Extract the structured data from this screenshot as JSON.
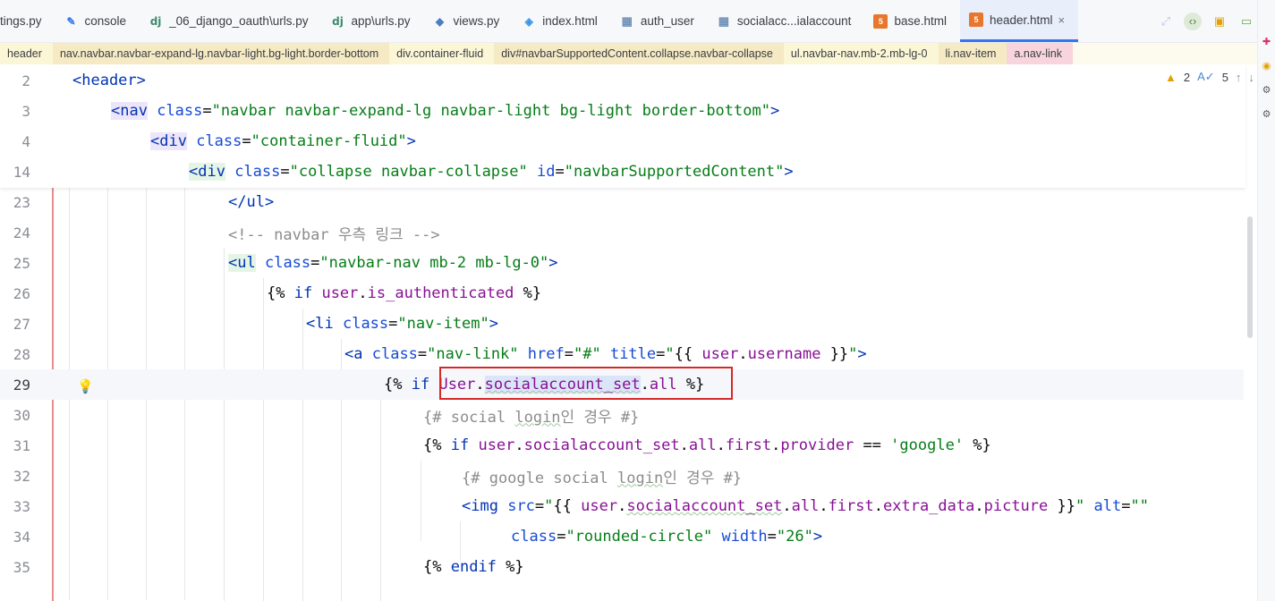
{
  "tabs": [
    {
      "label": "tings.py",
      "icon": "python-file-icon",
      "active": false
    },
    {
      "label": "console",
      "icon": "console-icon",
      "active": false
    },
    {
      "label": "_06_django_oauth\\urls.py",
      "icon": "django-icon",
      "active": false
    },
    {
      "label": "app\\urls.py",
      "icon": "django-icon",
      "active": false
    },
    {
      "label": "views.py",
      "icon": "python-file-icon",
      "active": false
    },
    {
      "label": "index.html",
      "icon": "vue-file-icon",
      "active": false
    },
    {
      "label": "auth_user",
      "icon": "table-icon",
      "active": false
    },
    {
      "label": "socialacc...ialaccount",
      "icon": "table-icon",
      "active": false
    },
    {
      "label": "base.html",
      "icon": "html-file-icon",
      "active": false
    },
    {
      "label": "header.html",
      "icon": "html-file-icon",
      "active": true
    }
  ],
  "breadcrumb": [
    "header",
    "nav.navbar.navbar-expand-lg.navbar-light.bg-light.border-bottom",
    "div.container-fluid",
    "div#navbarSupportedContent.collapse.navbar-collapse",
    "ul.navbar-nav.mb-2.mb-lg-0",
    "li.nav-item",
    "a.nav-link"
  ],
  "inspections": {
    "warnings": "2",
    "typos": "5"
  },
  "sticky_lines": [
    {
      "num": "2",
      "tokens": [
        [
          "tag",
          "<header>"
        ]
      ]
    },
    {
      "num": "3",
      "tokens": [
        [
          "tag tagbg",
          "<nav"
        ],
        [
          "plain",
          " "
        ],
        [
          "attr",
          "class"
        ],
        [
          "plain",
          "="
        ],
        [
          "str",
          "\"navbar navbar-expand-lg navbar-light bg-light border-bottom\""
        ],
        [
          "tag",
          ">"
        ]
      ]
    },
    {
      "num": "4",
      "tokens": [
        [
          "tag tagbg",
          "<div"
        ],
        [
          "plain",
          " "
        ],
        [
          "attr",
          "class"
        ],
        [
          "plain",
          "="
        ],
        [
          "str",
          "\"container-fluid\""
        ],
        [
          "tag",
          ">"
        ]
      ]
    },
    {
      "num": "14",
      "tokens": [
        [
          "tag tagbg2",
          "<div"
        ],
        [
          "plain",
          " "
        ],
        [
          "attr",
          "class"
        ],
        [
          "plain",
          "="
        ],
        [
          "str",
          "\"collapse navbar-collapse\""
        ],
        [
          "plain",
          " "
        ],
        [
          "attr",
          "id"
        ],
        [
          "plain",
          "="
        ],
        [
          "str",
          "\"navbarSupportedContent\""
        ],
        [
          "tag",
          ">"
        ]
      ]
    }
  ],
  "lines": [
    {
      "num": "23",
      "tokens": [
        [
          "tag",
          "</ul>"
        ]
      ]
    },
    {
      "num": "24",
      "tokens": [
        [
          "cmt",
          "<!-- navbar 우측 링크 -->"
        ]
      ]
    },
    {
      "num": "25",
      "tokens": [
        [
          "tag tagbg2",
          "<ul"
        ],
        [
          "plain",
          " "
        ],
        [
          "attr",
          "class"
        ],
        [
          "plain",
          "="
        ],
        [
          "str",
          "\"navbar-nav mb-2 mb-lg-0\""
        ],
        [
          "tag",
          ">"
        ]
      ]
    },
    {
      "num": "26",
      "tokens": [
        [
          "tpl",
          "{% "
        ],
        [
          "kw",
          "if"
        ],
        [
          "plain",
          " "
        ],
        [
          "var",
          "user"
        ],
        [
          "plain",
          "."
        ],
        [
          "var",
          "is_authenticated"
        ],
        [
          "tpl",
          " %}"
        ]
      ]
    },
    {
      "num": "27",
      "tokens": [
        [
          "tag",
          "<li"
        ],
        [
          "plain",
          " "
        ],
        [
          "attr",
          "class"
        ],
        [
          "plain",
          "="
        ],
        [
          "str",
          "\"nav-item\""
        ],
        [
          "tag",
          ">"
        ]
      ]
    },
    {
      "num": "28",
      "tokens": [
        [
          "tag",
          "<a"
        ],
        [
          "plain",
          " "
        ],
        [
          "attr",
          "class"
        ],
        [
          "plain",
          "="
        ],
        [
          "str",
          "\"nav-link\""
        ],
        [
          "plain",
          " "
        ],
        [
          "attr",
          "href"
        ],
        [
          "plain",
          "="
        ],
        [
          "str",
          "\"#\""
        ],
        [
          "plain",
          " "
        ],
        [
          "attr",
          "title"
        ],
        [
          "plain",
          "="
        ],
        [
          "str",
          "\""
        ],
        [
          "tpl",
          "{{ "
        ],
        [
          "var",
          "user"
        ],
        [
          "plain",
          "."
        ],
        [
          "var",
          "username"
        ],
        [
          "tpl",
          " }}"
        ],
        [
          "str",
          "\""
        ],
        [
          "tag",
          ">"
        ]
      ]
    },
    {
      "num": "29",
      "tokens": [
        [
          "tpl",
          "{% "
        ],
        [
          "kw",
          "if"
        ],
        [
          "plain",
          " "
        ],
        [
          "var",
          "User"
        ],
        [
          "plain",
          "."
        ],
        [
          "var sel sq",
          "socialaccount_set"
        ],
        [
          "plain",
          "."
        ],
        [
          "var",
          "all"
        ],
        [
          "tpl",
          " %}"
        ]
      ]
    },
    {
      "num": "30",
      "tokens": [
        [
          "cmt",
          "{# social "
        ],
        [
          "cmt sq",
          "login"
        ],
        [
          "cmt",
          "인 경우 #}"
        ]
      ]
    },
    {
      "num": "31",
      "tokens": [
        [
          "tpl",
          "{% "
        ],
        [
          "kw",
          "if"
        ],
        [
          "plain",
          " "
        ],
        [
          "var",
          "user"
        ],
        [
          "plain",
          "."
        ],
        [
          "var",
          "socialaccount_set"
        ],
        [
          "plain",
          "."
        ],
        [
          "var",
          "all"
        ],
        [
          "plain",
          "."
        ],
        [
          "var",
          "first"
        ],
        [
          "plain",
          "."
        ],
        [
          "var",
          "provider"
        ],
        [
          "plain",
          " == "
        ],
        [
          "str",
          "'google'"
        ],
        [
          "tpl",
          " %}"
        ]
      ]
    },
    {
      "num": "32",
      "tokens": [
        [
          "cmt",
          "{# google social "
        ],
        [
          "cmt sq",
          "login"
        ],
        [
          "cmt",
          "인 경우 #}"
        ]
      ]
    },
    {
      "num": "33",
      "tokens": [
        [
          "tag",
          "<img"
        ],
        [
          "plain",
          " "
        ],
        [
          "attr",
          "src"
        ],
        [
          "plain",
          "="
        ],
        [
          "str",
          "\""
        ],
        [
          "tpl",
          "{{ "
        ],
        [
          "var",
          "user"
        ],
        [
          "plain",
          "."
        ],
        [
          "var sq",
          "socialaccount_set"
        ],
        [
          "plain",
          "."
        ],
        [
          "var",
          "all"
        ],
        [
          "plain",
          "."
        ],
        [
          "var",
          "first"
        ],
        [
          "plain",
          "."
        ],
        [
          "var",
          "extra_data"
        ],
        [
          "plain",
          "."
        ],
        [
          "var",
          "picture"
        ],
        [
          "tpl",
          " }}"
        ],
        [
          "str",
          "\""
        ],
        [
          "plain",
          " "
        ],
        [
          "attr",
          "alt"
        ],
        [
          "plain",
          "="
        ],
        [
          "str",
          "\"\""
        ]
      ]
    },
    {
      "num": "34",
      "tokens": [
        [
          "attr",
          "class"
        ],
        [
          "plain",
          "="
        ],
        [
          "str",
          "\"rounded-circle\""
        ],
        [
          "plain",
          " "
        ],
        [
          "attr",
          "width"
        ],
        [
          "plain",
          "="
        ],
        [
          "str",
          "\"26\""
        ],
        [
          "tag",
          ">"
        ]
      ]
    },
    {
      "num": "35",
      "tokens": [
        [
          "tpl",
          "{% "
        ],
        [
          "kw",
          "endif"
        ],
        [
          "tpl",
          " %}"
        ]
      ]
    }
  ],
  "colors": {
    "accent": "#3574f0",
    "highlight_box": "#d62828"
  }
}
